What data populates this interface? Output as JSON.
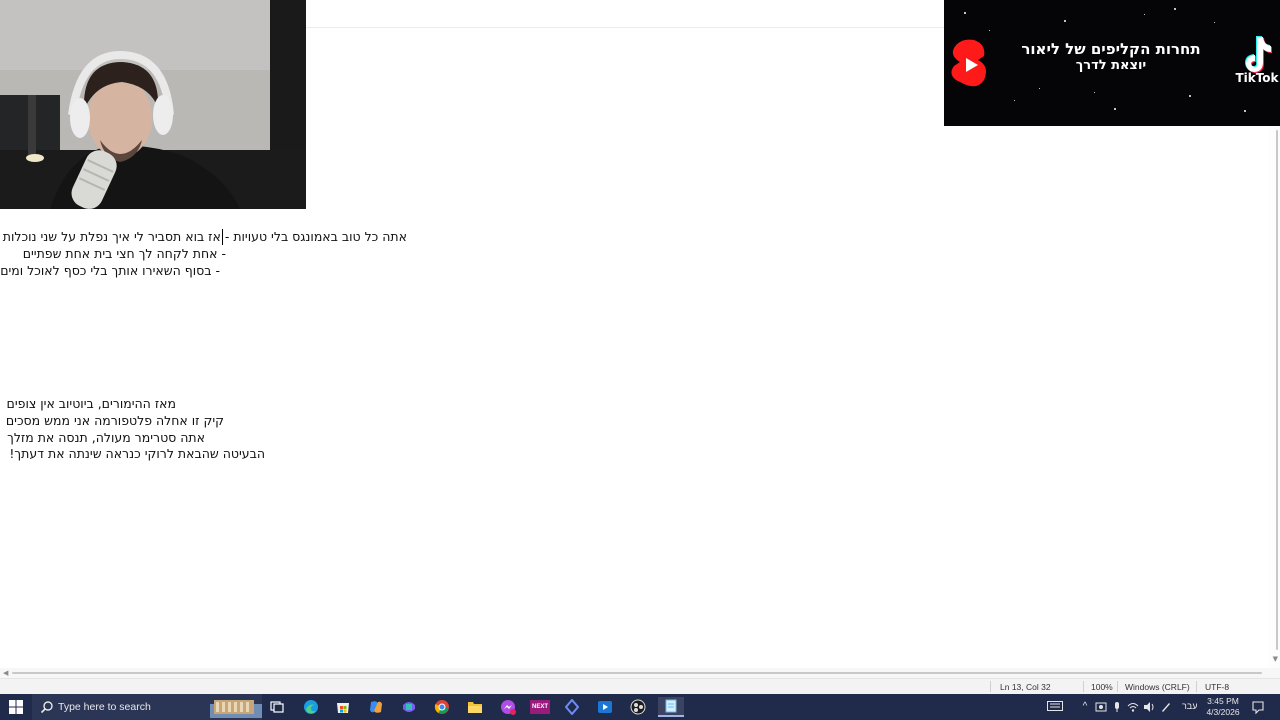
{
  "editor": {
    "lines": [
      "אתה כל טוב באמונגס בלי טעויות - אז בוא תסביר לי איך נפלת על שני נוכלות",
      "- אחת לקחה לך חצי בית אחת שפתיים",
      "- בסוף השאירו אותך בלי כסף לאוכל ומים",
      "מאז ההימורים, ביוטיוב אין צופים",
      "קיק זו אחלה פלטפורמה אני ממש מסכים",
      "אתה סטרימר מעולה, תנסה את מזלך",
      "הבעיטה שהבאת לרוקי כנראה שינתה את דעתך!"
    ]
  },
  "status_bar": {
    "position": "Ln 13, Col 32",
    "zoom": "100%",
    "line_ending": "Windows (CRLF)",
    "encoding": "UTF-8"
  },
  "banner": {
    "title": "תחרות הקליפים של ליאור",
    "subtitle": "יוצאת לדרך",
    "tiktok_label": "TikTok"
  },
  "taskbar": {
    "search_placeholder": "Type here to search",
    "next_label": "NEXT",
    "language": "עבר",
    "time": "3:45 PM",
    "date": "4/3/2026",
    "apps": [
      "task-view",
      "edge",
      "store",
      "copilot",
      "office",
      "chrome",
      "file-explorer",
      "messenger",
      "next",
      "proton-vpn",
      "media",
      "obs",
      "notepad"
    ]
  },
  "colors": {
    "taskbar_bg": "#202a4a",
    "youtube_red": "#ff1a1a",
    "banner_bg": "#050508"
  }
}
